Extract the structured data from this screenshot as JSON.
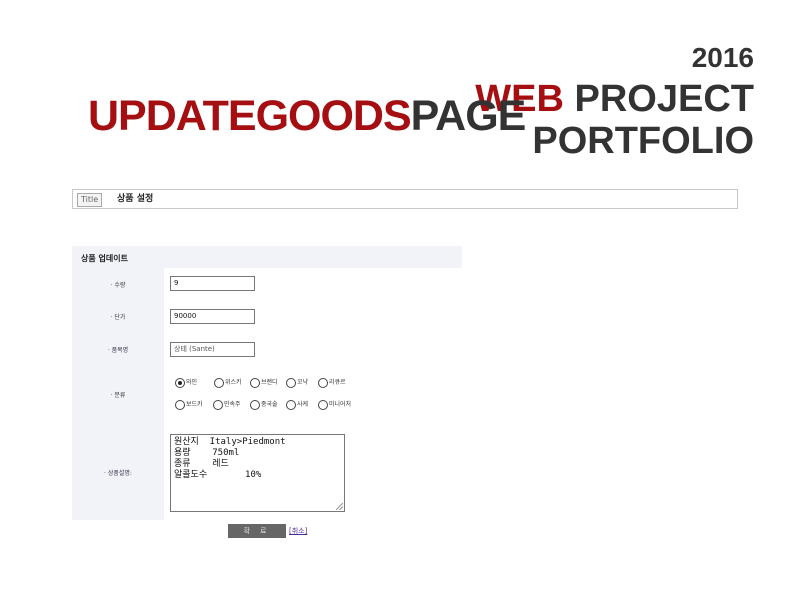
{
  "header": {
    "year": "2016",
    "web": "WEB",
    "project": "PROJECT",
    "portfolio": "PORTFOLIO",
    "page_name_red": "UPDATEGOODS",
    "page_name_dark": "PAGE"
  },
  "title_bar": {
    "tag": "Title",
    "text": "상품 설정"
  },
  "form": {
    "heading": "상품 업데이트",
    "labels": {
      "quantity": "· 수량",
      "price": "· 단가",
      "product_name": "· 품목명",
      "category": "· 분류",
      "description": "· 상품설명:"
    },
    "values": {
      "quantity": "9",
      "price": "90000",
      "product_name": "상테 (Sante)"
    },
    "categories": [
      {
        "label": "와인",
        "checked": true
      },
      {
        "label": "위스키",
        "checked": false
      },
      {
        "label": "브랜디",
        "checked": false
      },
      {
        "label": "꼬냑",
        "checked": false
      },
      {
        "label": "리큐르",
        "checked": false
      },
      {
        "label": "보드카",
        "checked": false
      },
      {
        "label": "민속주",
        "checked": false
      },
      {
        "label": "중국술",
        "checked": false
      },
      {
        "label": "사케",
        "checked": false
      },
      {
        "label": "미니어처",
        "checked": false
      }
    ],
    "description_lines": [
      "원산지  Italy>Piedmont",
      "용량    750ml",
      "종류    레드",
      "알콜도수       10%"
    ],
    "submit_label": "확 료",
    "cancel_label": "[취소]"
  }
}
